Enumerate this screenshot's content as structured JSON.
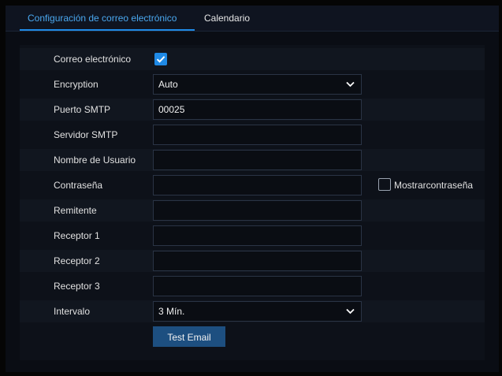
{
  "tabs": [
    {
      "label": "Configuración de correo electrónico",
      "active": true
    },
    {
      "label": "Calendario",
      "active": false
    }
  ],
  "form": {
    "email_enable": {
      "label": "Correo electrónico",
      "checked": true
    },
    "encryption": {
      "label": "Encryption",
      "value": "Auto"
    },
    "smtp_port": {
      "label": "Puerto SMTP",
      "value": "00025"
    },
    "smtp_server": {
      "label": "Servidor SMTP",
      "value": ""
    },
    "username": {
      "label": "Nombre de Usuario",
      "value": ""
    },
    "password": {
      "label": "Contraseña",
      "value": "",
      "show_label": "Mostrarcontraseña",
      "show_checked": false
    },
    "sender": {
      "label": "Remitente",
      "value": ""
    },
    "receiver1": {
      "label": "Receptor 1",
      "value": ""
    },
    "receiver2": {
      "label": "Receptor 2",
      "value": ""
    },
    "receiver3": {
      "label": "Receptor 3",
      "value": ""
    },
    "interval": {
      "label": "Intervalo",
      "value": "3 Mín."
    },
    "test_button": "Test Email"
  },
  "colors": {
    "accent": "#1f8ae6",
    "button": "#1d4f80",
    "background": "#0a0d14"
  },
  "icons": [
    "checkbox-checked-icon",
    "chevron-down-icon",
    "checkbox-empty-icon"
  ]
}
